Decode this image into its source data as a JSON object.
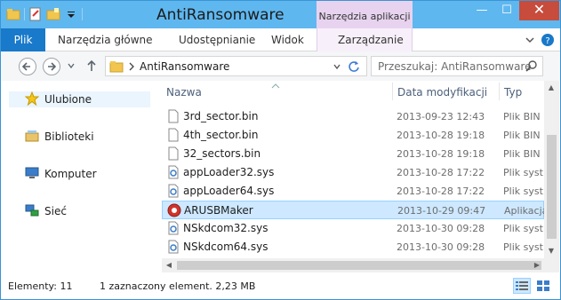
{
  "window": {
    "title": "AntiRansomware",
    "contextual_tab": "Narzędzia aplikacji",
    "controls": {
      "minimize": "—",
      "maximize": "☐",
      "close": "✕"
    }
  },
  "ribbon": {
    "tabs": [
      "Plik",
      "Narzędzia główne",
      "Udostępnianie",
      "Widok",
      "Zarządzanie"
    ]
  },
  "address": {
    "path": "AntiRansomware",
    "search_placeholder": "Przeszukaj: AntiRansomware"
  },
  "nav": {
    "items": [
      {
        "label": "Ulubione",
        "icon": "star-icon"
      },
      {
        "label": "Biblioteki",
        "icon": "library-icon"
      },
      {
        "label": "Komputer",
        "icon": "computer-icon"
      },
      {
        "label": "Sieć",
        "icon": "network-icon"
      }
    ]
  },
  "columns": {
    "name": "Nazwa",
    "date": "Data modyfikacji",
    "type": "Typ"
  },
  "files": [
    {
      "name": "3rd_sector.bin",
      "date": "2013-09-23 12:43",
      "type": "Plik BIN",
      "icon": "blank-file-icon"
    },
    {
      "name": "4th_sector.bin",
      "date": "2013-10-28 19:18",
      "type": "Plik BIN",
      "icon": "blank-file-icon"
    },
    {
      "name": "32_sectors.bin",
      "date": "2013-10-28 19:18",
      "type": "Plik BIN",
      "icon": "blank-file-icon"
    },
    {
      "name": "appLoader32.sys",
      "date": "2013-10-28 17:22",
      "type": "Plik syst",
      "icon": "system-file-icon"
    },
    {
      "name": "appLoader64.sys",
      "date": "2013-10-28 17:22",
      "type": "Plik syst",
      "icon": "system-file-icon"
    },
    {
      "name": "ARUSBMaker",
      "date": "2013-10-29 09:47",
      "type": "Aplikacja",
      "icon": "app-icon",
      "selected": true
    },
    {
      "name": "NSkdcom32.sys",
      "date": "2013-10-30 09:28",
      "type": "Plik syst",
      "icon": "system-file-icon"
    },
    {
      "name": "NSkdcom64.sys",
      "date": "2013-10-30 09:28",
      "type": "Plik syst",
      "icon": "system-file-icon"
    }
  ],
  "status": {
    "count": "Elementy: 11",
    "selection": "1 zaznaczony element. 2,23 MB"
  },
  "colors": {
    "accent": "#1979ca",
    "title_bg": "#5fb7ef",
    "selection": "#cde8ff",
    "contextual": "#e7d3ef"
  }
}
